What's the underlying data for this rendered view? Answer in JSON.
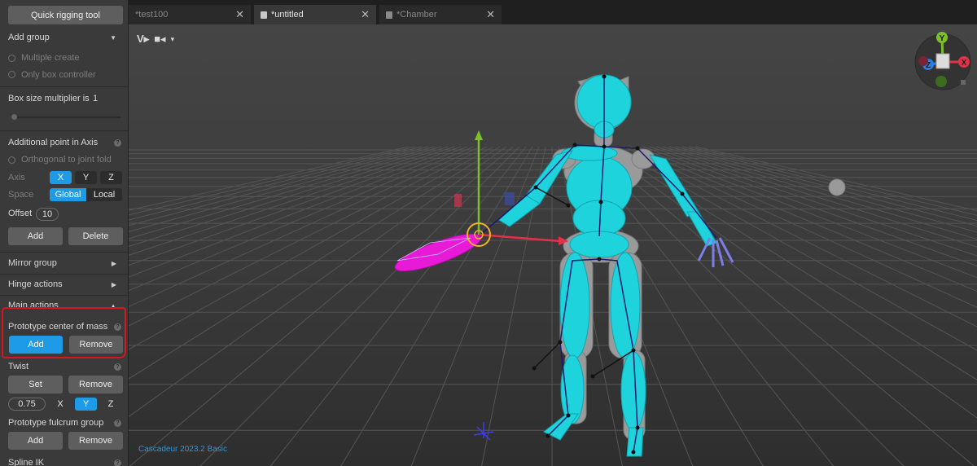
{
  "panel": {
    "quick_rigging_label": "Quick rigging tool",
    "add_group": {
      "title": "Add group",
      "multiple_create": "Multiple create",
      "only_box_controller": "Only box controller"
    },
    "box_size": {
      "label": "Box size multiplier is",
      "value": "1"
    },
    "additional_point": {
      "title": "Additional point in Axis",
      "orthogonal": "Orthogonal to joint fold",
      "axis_label": "Axis",
      "axis_x": "X",
      "axis_y": "Y",
      "axis_z": "Z",
      "space_label": "Space",
      "space_global": "Global",
      "space_local": "Local",
      "offset_label": "Offset",
      "offset_value": "10",
      "add": "Add",
      "delete": "Delete"
    },
    "mirror_group": "Mirror group",
    "hinge_actions": "Hinge actions",
    "main_actions": "Main actions",
    "prototype_com": {
      "title": "Prototype center of mass",
      "add": "Add",
      "remove": "Remove"
    },
    "twist": {
      "title": "Twist",
      "set": "Set",
      "remove": "Remove",
      "value": "0.75",
      "x": "X",
      "y": "Y",
      "z": "Z"
    },
    "prototype_fulcrum": {
      "title": "Prototype fulcrum group",
      "add": "Add",
      "remove": "Remove"
    },
    "spline_ik": "Spline IK"
  },
  "tabs": [
    {
      "label": "*test100",
      "active": false
    },
    {
      "label": "*untitled",
      "active": true
    },
    {
      "label": "*Chamber",
      "active": false
    }
  ],
  "viewport": {
    "brand": "Cascadeur 2023.2 Basic",
    "gizmo": {
      "y": "Y",
      "x": "X",
      "z": "Z"
    }
  },
  "colors": {
    "accent": "#1e9be6",
    "highlight": "#d8161b",
    "body": "#1fd3dc",
    "selected": "#e81ad8"
  }
}
